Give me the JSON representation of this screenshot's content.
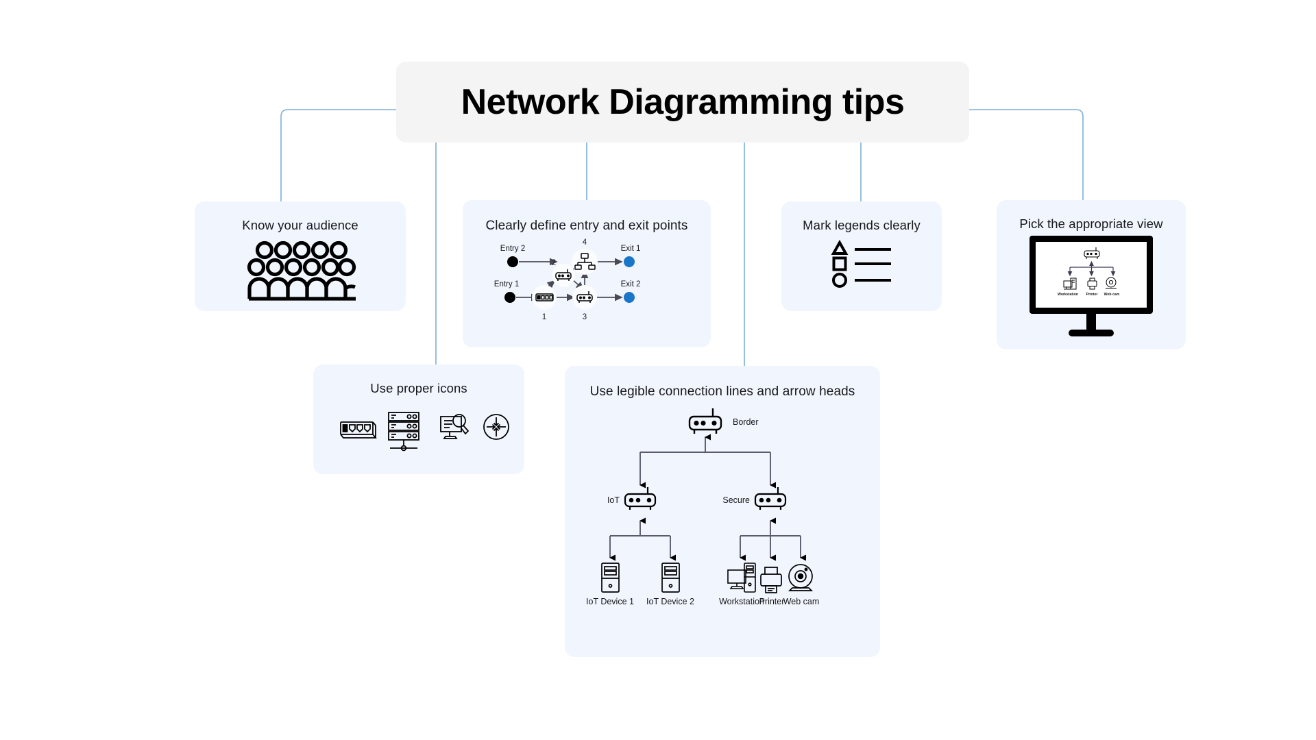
{
  "title": "Network Diagramming tips",
  "theme": {
    "page_bg": "#ffffff",
    "card_bg": "#f1f5fd",
    "title_bg": "#f4f4f4",
    "connector": "#7dafd4",
    "accent_blue": "#1976c8",
    "ink": "#17181a"
  },
  "cards": {
    "audience": {
      "title": "Know your audience"
    },
    "entryexit": {
      "title": "Clearly define entry and exit points",
      "nodes": [
        {
          "id": "1",
          "label": "1",
          "icon": "switch-icon"
        },
        {
          "id": "2",
          "label": "2",
          "icon": "router-icon"
        },
        {
          "id": "3",
          "label": "3",
          "icon": "router-icon"
        },
        {
          "id": "4",
          "label": "4",
          "icon": "network-icon"
        }
      ],
      "entries": [
        "Entry 1",
        "Entry 2"
      ],
      "exits": [
        "Exit 1",
        "Exit 2"
      ]
    },
    "legends": {
      "title": "Mark legends clearly",
      "items": [
        "triangle-icon",
        "square-icon",
        "circle-icon"
      ]
    },
    "view": {
      "title": "Pick the appropriate view",
      "screen_nodes": [
        "Workstation",
        "Printer",
        "Web cam"
      ],
      "screen_root": "router-icon"
    },
    "icons": {
      "title": "Use proper icons",
      "items": [
        "switch-icon",
        "server-rack-icon",
        "monitoring-icon",
        "router-circle-icon"
      ]
    },
    "lines": {
      "title": "Use legible connection lines and arrow heads",
      "border_label": "Border",
      "iot_label": "IoT",
      "secure_label": "Secure",
      "iot_devices": [
        "IoT Device 1",
        "IoT Device 2"
      ],
      "secure_devices": [
        "Workstation",
        "Printer",
        "Web cam"
      ]
    }
  }
}
